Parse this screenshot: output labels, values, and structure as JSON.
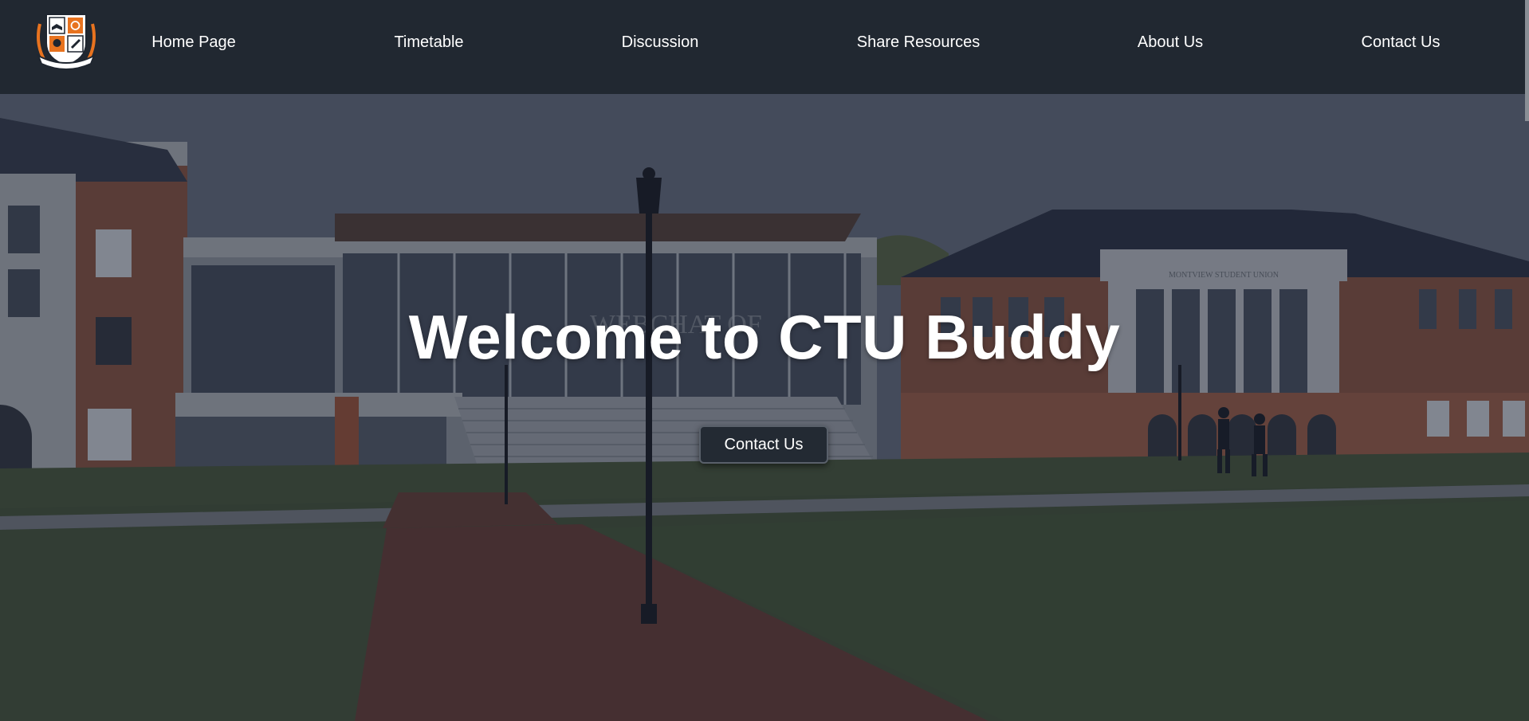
{
  "nav": {
    "logo_icon": "college-crest-icon",
    "items": [
      {
        "label": "Home Page"
      },
      {
        "label": "Timetable"
      },
      {
        "label": "Discussion"
      },
      {
        "label": "Share Resources"
      },
      {
        "label": "About Us"
      },
      {
        "label": "Contact Us"
      }
    ]
  },
  "hero": {
    "title": "Welcome to CTU Buddy",
    "button_label": "Contact Us",
    "building_sign_left": "WEBCHAT OF",
    "building_sign_right": "MONTVIEW STUDENT UNION",
    "background": "campus-photo"
  },
  "colors": {
    "nav_bg": "#212831",
    "accent": "#e8731f",
    "button_bg": "#232a33"
  }
}
